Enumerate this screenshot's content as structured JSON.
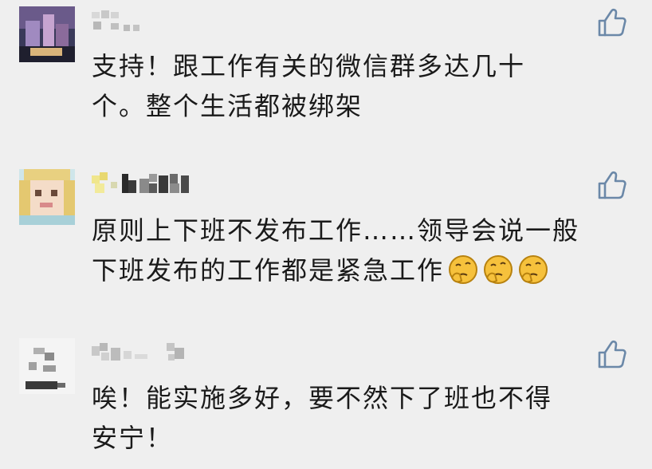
{
  "comments": [
    {
      "avatar_icon": "user-avatar-blurred",
      "name_icon": "pixelated-username",
      "text_line1": "支持！跟工作有关的微信群多达几十",
      "text_line2": "个。整个生活都被绑架",
      "like_icon": "thumbs-up-icon"
    },
    {
      "avatar_icon": "user-avatar-blurred",
      "name_icon": "pixelated-username",
      "text_line1": "原则上下班不发布工作……领导会说一般",
      "text_line2": "下班发布的工作都是紧急工作",
      "emojis": [
        "thinking-face-emoji",
        "thinking-face-emoji",
        "thinking-face-emoji"
      ],
      "like_icon": "thumbs-up-icon"
    },
    {
      "avatar_icon": "user-avatar-blurred",
      "name_icon": "pixelated-username",
      "text_line1": "唉！能实施多好，要不然下了班也不得",
      "text_line2": "安宁！",
      "like_icon": "thumbs-up-icon"
    }
  ],
  "colors": {
    "background": "#efefef",
    "like_icon": "#6b88a8",
    "text": "#1a1a1a",
    "emoji": "#f6c13c"
  }
}
